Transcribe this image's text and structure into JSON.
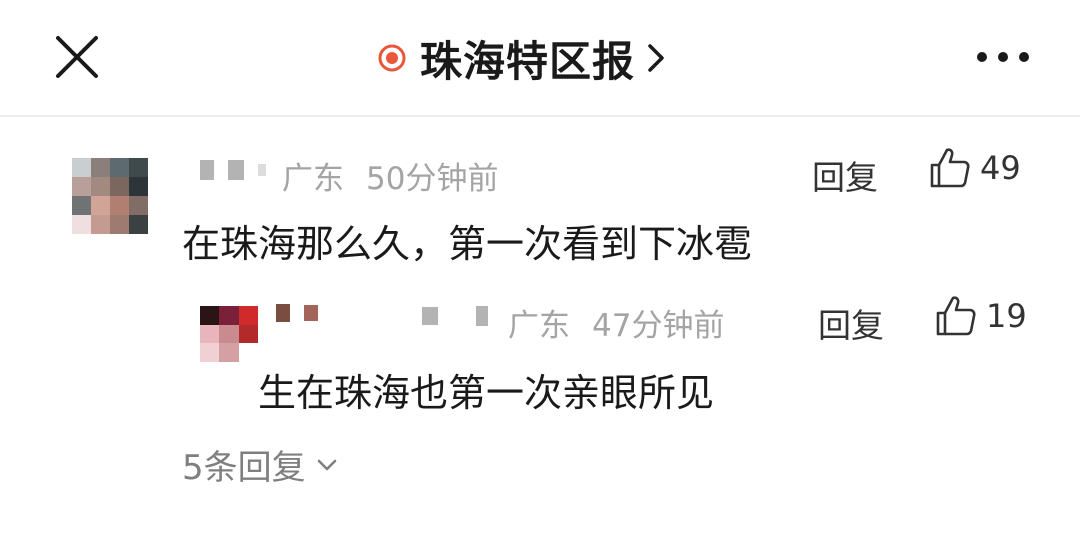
{
  "header": {
    "title": "珠海特区报",
    "close_icon": "close-icon",
    "live_icon": "live-dot-icon",
    "chevron_icon": "chevron-right-icon",
    "more_icon": "more-horizontal-icon"
  },
  "comments": [
    {
      "location": "广东",
      "time": "50分钟前",
      "reply_label": "回复",
      "likes": "49",
      "text": "在珠海那么久，第一次看到下冰雹"
    }
  ],
  "replies": [
    {
      "location": "广东",
      "time": "47分钟前",
      "reply_label": "回复",
      "likes": "19",
      "text": "生在珠海也第一次亲眼所见"
    }
  ],
  "more_replies": {
    "label": "5条回复",
    "icon": "chevron-down-icon"
  },
  "colors": {
    "accent": "#e8573a",
    "meta_text": "#a4a4a4",
    "body_text": "#1a1a1a"
  }
}
